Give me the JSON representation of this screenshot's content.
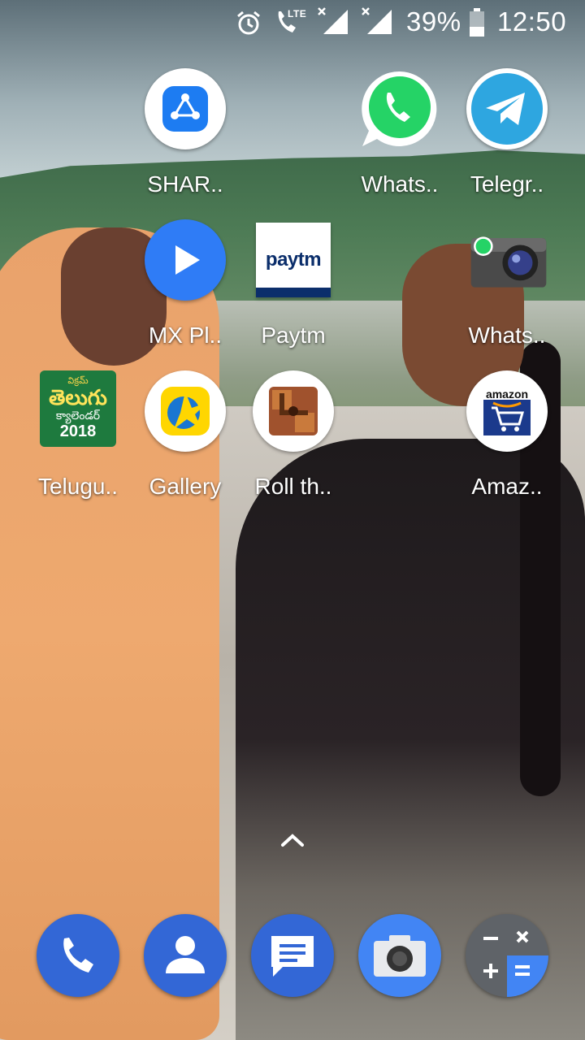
{
  "status_bar": {
    "battery": "39%",
    "time": "12:50",
    "network_label": "LTE",
    "icons": [
      "alarm-icon",
      "volte-call-icon",
      "signal-sim1-icon",
      "signal-sim2-icon",
      "battery-icon"
    ]
  },
  "home_apps": [
    {
      "label": "SHAR..",
      "icon": "shareit-icon"
    },
    {
      "label": "Whats..",
      "icon": "whatsapp-icon"
    },
    {
      "label": "Telegr..",
      "icon": "telegram-icon"
    },
    {
      "label": "MX Pl..",
      "icon": "mx-player-icon"
    },
    {
      "label": "Paytm",
      "icon": "paytm-icon",
      "icon_text": "paytm"
    },
    {
      "label": "Whats..",
      "icon": "whatsapp-camera-icon"
    },
    {
      "label": "Telugu..",
      "icon": "telugu-calendar-icon",
      "icon_text": "తెలుగు",
      "icon_subtext": "క్యాలెండర్",
      "icon_year": "2018",
      "icon_top": "విక్రమ్"
    },
    {
      "label": "Gallery",
      "icon": "gallery-icon"
    },
    {
      "label": "Roll th..",
      "icon": "roll-the-ball-icon"
    },
    {
      "label": "Amaz..",
      "icon": "amazon-icon",
      "icon_text": "amazon"
    }
  ],
  "dock": [
    {
      "icon": "phone-icon",
      "color": "#3367d6"
    },
    {
      "icon": "contacts-icon",
      "color": "#3367d6"
    },
    {
      "icon": "messages-icon",
      "color": "#3367d6"
    },
    {
      "icon": "camera-icon",
      "color": "#4285f4"
    },
    {
      "icon": "calculator-icon",
      "color": "#5f6368"
    }
  ],
  "colors": {
    "shareit": "#1d7cf2",
    "whatsapp": "#25d366",
    "telegram": "#2ea6e0",
    "mx_player": "#2f7cf6",
    "paytm_blue": "#0b2e6b",
    "paytm_light": "#00b9f1",
    "amazon_orange": "#ff9900",
    "calculator_blue": "#4285f4"
  }
}
